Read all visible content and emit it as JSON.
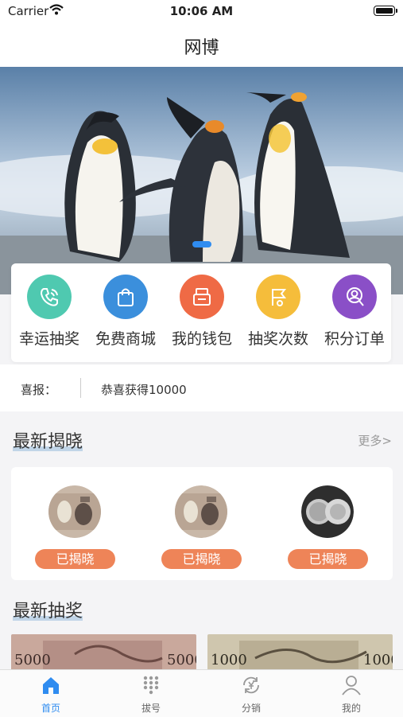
{
  "status_bar": {
    "carrier": "Carrier",
    "time": "10:06 AM"
  },
  "nav": {
    "title": "网博"
  },
  "banner": {
    "image": "penguins-photo",
    "indicator_index": 0
  },
  "quick_menu": [
    {
      "label": "幸运抽奖",
      "icon": "phone-icon",
      "color": "#4fc9b0"
    },
    {
      "label": "免费商城",
      "icon": "shopping-bag-icon",
      "color": "#3b8fdc"
    },
    {
      "label": "我的钱包",
      "icon": "wallet-icon",
      "color": "#ef6a45"
    },
    {
      "label": "抽奖次数",
      "icon": "flag-icon",
      "color": "#f5bd3b"
    },
    {
      "label": "积分订单",
      "icon": "user-search-icon",
      "color": "#8a4fc7"
    }
  ],
  "news": {
    "label": "喜报：",
    "text": "恭喜获得10000"
  },
  "latest_reveal": {
    "title": "最新揭晓",
    "more": "更多>",
    "items": [
      {
        "image": "banknote-coin-image",
        "status": "已揭晓"
      },
      {
        "image": "banknote-coin-image",
        "status": "已揭晓"
      },
      {
        "image": "silver-coin-image",
        "status": "已揭晓"
      }
    ]
  },
  "latest_lottery": {
    "title": "最新抽奖",
    "items": [
      {
        "image": "banknote-5000-image",
        "denomination": "5000"
      },
      {
        "image": "banknote-1000-image",
        "denomination": "1000"
      }
    ]
  },
  "tab_bar": {
    "active": 0,
    "items": [
      {
        "label": "首页",
        "icon": "home-icon"
      },
      {
        "label": "拔号",
        "icon": "keypad-icon"
      },
      {
        "label": "分销",
        "icon": "yen-refresh-icon"
      },
      {
        "label": "我的",
        "icon": "person-icon"
      }
    ]
  },
  "colors": {
    "accent": "#2f8cf0",
    "reveal_button": "#ee8458"
  }
}
